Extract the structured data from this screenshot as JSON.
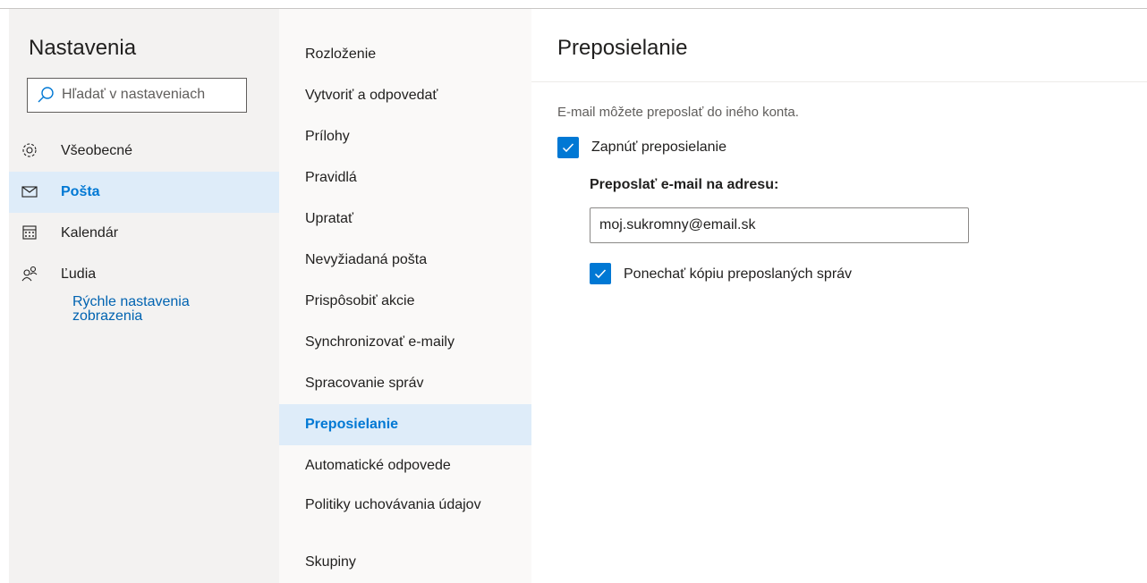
{
  "sidebar": {
    "title": "Nastavenia",
    "search_placeholder": "Hľadať v nastaveniach",
    "items": [
      {
        "label": "Všeobecné",
        "icon": "gear-icon"
      },
      {
        "label": "Pošta",
        "icon": "mail-icon",
        "active": true
      },
      {
        "label": "Kalendár",
        "icon": "calendar-icon"
      },
      {
        "label": "Ľudia",
        "icon": "people-icon"
      }
    ],
    "quick_settings_link": "Rýchle nastavenia zobrazenia"
  },
  "submenu": {
    "items": [
      {
        "label": "Rozloženie"
      },
      {
        "label": "Vytvoriť a odpovedať"
      },
      {
        "label": "Prílohy"
      },
      {
        "label": "Pravidlá"
      },
      {
        "label": "Upratať"
      },
      {
        "label": "Nevyžiadaná pošta"
      },
      {
        "label": "Prispôsobiť akcie"
      },
      {
        "label": "Synchronizovať e-maily"
      },
      {
        "label": "Spracovanie správ"
      },
      {
        "label": "Preposielanie",
        "active": true
      },
      {
        "label": "Automatické odpovede"
      },
      {
        "label": "Politiky uchovávania údajov"
      },
      {
        "label": "Skupiny"
      }
    ]
  },
  "panel": {
    "title": "Preposielanie",
    "description": "E-mail môžete preposlať do iného konta.",
    "enable_forwarding": {
      "label": "Zapnúť preposielanie",
      "checked": true
    },
    "forward_to_label": "Preposlať e-mail na adresu:",
    "forward_to_value": "moj.sukromny@email.sk",
    "keep_copy": {
      "label": "Ponechať kópiu preposlaných správ",
      "checked": true
    }
  },
  "colors": {
    "accent": "#0078d4",
    "active_bg": "#deecf9",
    "link": "#0063b1",
    "left_pane_bg": "#f3f2f1",
    "middle_pane_bg": "#faf9f8"
  }
}
